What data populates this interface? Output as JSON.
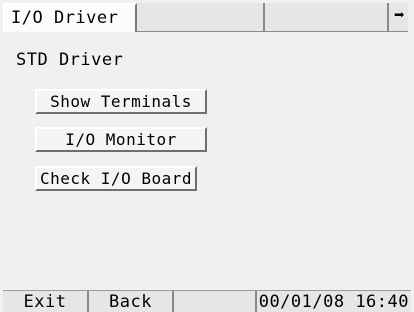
{
  "tabs": {
    "active_label": "I/O Driver",
    "empty_1": "",
    "empty_2": "",
    "next_arrow": "➡"
  },
  "section": {
    "title": "STD Driver"
  },
  "menu": {
    "show_terminals": "Show Terminals",
    "io_monitor": "I/O Monitor",
    "check_io_board": "Check I/O Board"
  },
  "bottom_bar": {
    "exit_label": "Exit",
    "back_label": "Back",
    "blank": "",
    "datetime": "00/01/08 16:40"
  }
}
